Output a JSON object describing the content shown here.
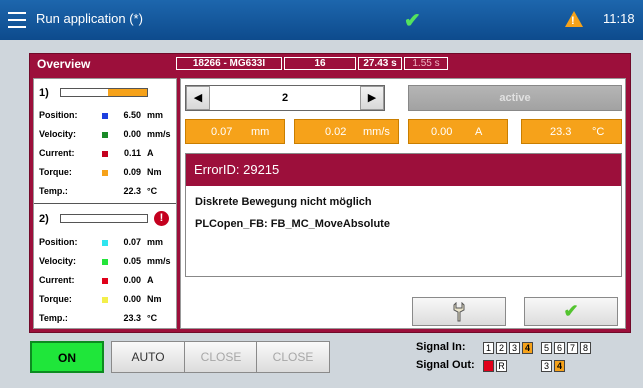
{
  "titlebar": {
    "title": "Run application (*)",
    "clock": "11:18",
    "status_icon": "check-icon",
    "warning_icon": "warning-icon"
  },
  "panel": {
    "title": "Overview",
    "header_fields": [
      "18266 - MG633I",
      "16",
      "27.43 s",
      "1.55 s"
    ]
  },
  "axes": [
    {
      "label": "1)",
      "bar_level": 0.45,
      "has_error": false,
      "rows": [
        {
          "label": "Position:",
          "value": "6.50",
          "unit": "mm",
          "color": "#1d3fe0"
        },
        {
          "label": "Velocity:",
          "value": "0.00",
          "unit": "mm/s",
          "color": "#1a8a27"
        },
        {
          "label": "Current:",
          "value": "0.11",
          "unit": "A",
          "color": "#c4001f"
        },
        {
          "label": "Torque:",
          "value": "0.09",
          "unit": "Nm",
          "color": "#f6a21a"
        },
        {
          "label": "Temp.:",
          "value": "22.3",
          "unit": "°C",
          "color": ""
        }
      ]
    },
    {
      "label": "2)",
      "bar_level": 0,
      "has_error": true,
      "error_glyph": "!",
      "rows": [
        {
          "label": "Position:",
          "value": "0.07",
          "unit": "mm",
          "color": "#2fe5ef"
        },
        {
          "label": "Velocity:",
          "value": "0.05",
          "unit": "mm/s",
          "color": "#23e43a"
        },
        {
          "label": "Current:",
          "value": "0.00",
          "unit": "A",
          "color": "#e0001a"
        },
        {
          "label": "Torque:",
          "value": "0.00",
          "unit": "Nm",
          "color": "#f3ef4a"
        },
        {
          "label": "Temp.:",
          "value": "23.3",
          "unit": "°C",
          "color": ""
        }
      ]
    }
  ],
  "selector": {
    "value": "2",
    "prev_glyph": "◀",
    "next_glyph": "▶"
  },
  "active_button": "active",
  "value_boxes": [
    {
      "value": "0.07",
      "unit": "mm"
    },
    {
      "value": "0.02",
      "unit": "mm/s"
    },
    {
      "value": "0.00",
      "unit": "A"
    },
    {
      "value": "23.3",
      "unit": "°C"
    }
  ],
  "error": {
    "title": "ErrorID: 29215",
    "message": "Diskrete Bewegung nicht möglich",
    "source": "PLCopen_FB: FB_MC_MoveAbsolute"
  },
  "action_buttons": {
    "reset_icon": "wrench-icon",
    "confirm_icon": "check-icon"
  },
  "bottom": {
    "on_label": "ON",
    "auto_label": "AUTO",
    "close1_label": "CLOSE",
    "close2_label": "CLOSE",
    "signal_in_label": "Signal In:",
    "signal_out_label": "Signal Out:",
    "signal_in": [
      {
        "n": "1",
        "state": "off"
      },
      {
        "n": "2",
        "state": "off"
      },
      {
        "n": "3",
        "state": "off"
      },
      {
        "n": "4",
        "state": "on"
      },
      {
        "n": "5",
        "state": "off"
      },
      {
        "n": "6",
        "state": "off"
      },
      {
        "n": "7",
        "state": "off"
      },
      {
        "n": "8",
        "state": "off"
      }
    ],
    "signal_out": [
      {
        "n": "F",
        "state": "red"
      },
      {
        "n": "R",
        "state": "off"
      },
      {
        "n": "3",
        "state": "off"
      },
      {
        "n": "4",
        "state": "on"
      }
    ]
  },
  "colors": {
    "accent": "#9c0f3b",
    "orange": "#f6a21a",
    "on_green": "#1fe63a"
  }
}
